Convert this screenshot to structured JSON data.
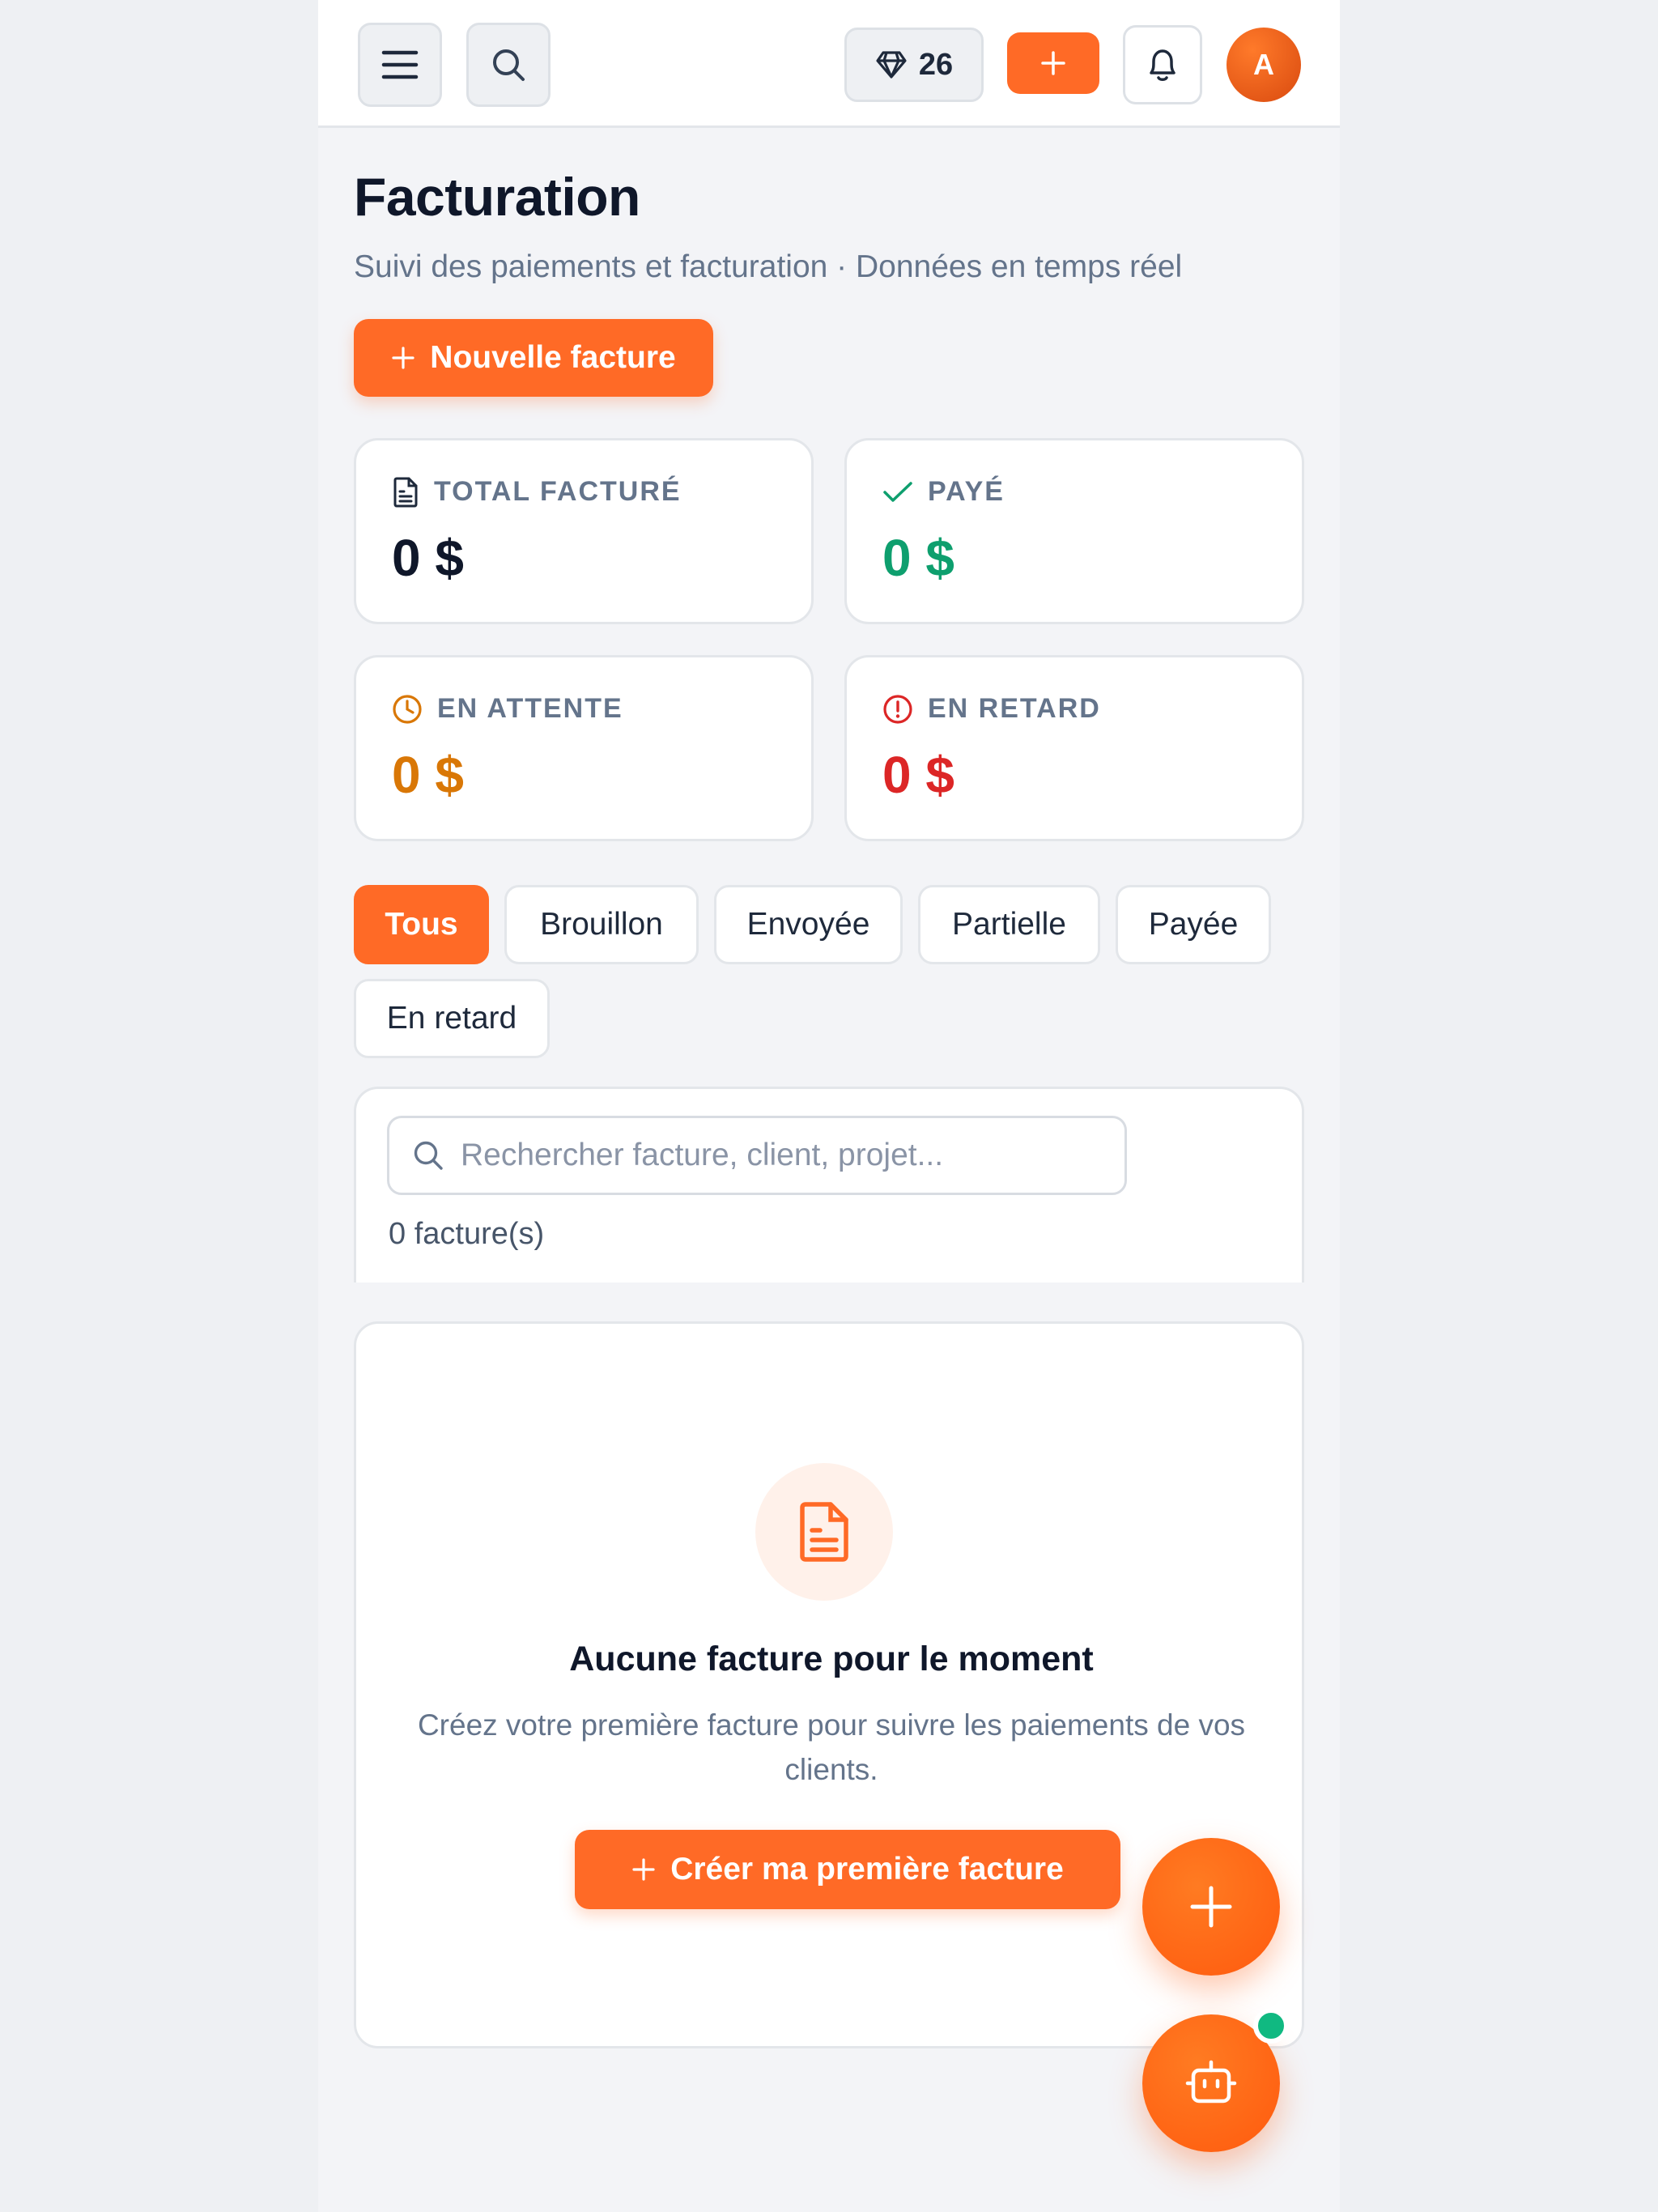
{
  "header": {
    "gems_count": "26",
    "avatar_initial": "A"
  },
  "page": {
    "title": "Facturation",
    "subtitle": "Suivi des paiements et facturation · Données en temps réel",
    "new_invoice_label": "Nouvelle facture"
  },
  "stats": [
    {
      "label": "TOTAL FACTURÉ",
      "value": "0 $",
      "color": "#0f172a",
      "icon": "document-icon"
    },
    {
      "label": "PAYÉ",
      "value": "0 $",
      "color": "#0e9f6e",
      "icon": "check-icon"
    },
    {
      "label": "EN ATTENTE",
      "value": "0 $",
      "color": "#d97706",
      "icon": "clock-icon"
    },
    {
      "label": "EN RETARD",
      "value": "0 $",
      "color": "#dc2626",
      "icon": "alert-circle-icon"
    }
  ],
  "filters": [
    "Tous",
    "Brouillon",
    "Envoyée",
    "Partielle",
    "Payée",
    "En retard"
  ],
  "active_filter": "Tous",
  "search": {
    "placeholder": "Rechercher facture, client, projet...",
    "value": ""
  },
  "results_count": "0 facture(s)",
  "empty_state": {
    "title": "Aucune facture pour le moment",
    "description": "Créez votre première facture pour suivre les paiements de vos clients.",
    "cta_label": "Créer ma première facture"
  },
  "colors": {
    "accent": "#ff6a26",
    "success": "#10b981"
  }
}
